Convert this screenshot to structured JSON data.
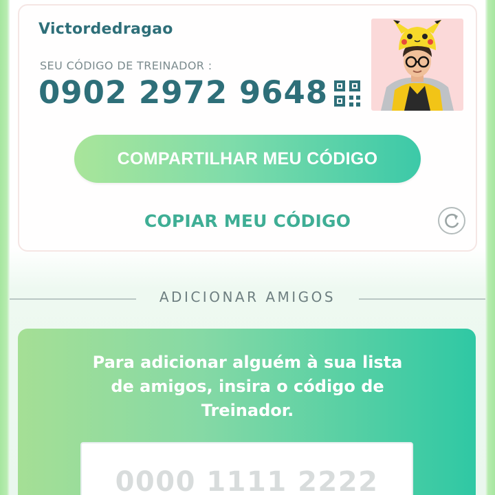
{
  "trainer": {
    "username": "Victordedragao",
    "code_label": "SEU CÓDIGO DE TREINADOR :",
    "code": "0902 2972 9648"
  },
  "icons": {
    "qr": "qr-code-icon",
    "refresh": "refresh-icon",
    "avatar": "trainer-avatar"
  },
  "actions": {
    "share_label": "COMPARTILHAR MEU CÓDIGO",
    "copy_label": "COPIAR MEU CÓDIGO"
  },
  "add_friends": {
    "section_title": "ADICIONAR AMIGOS",
    "instruction": "Para adicionar alguém à sua lista de amigos, insira o código de Treinador.",
    "input_placeholder": "0000 1111 2222"
  },
  "colors": {
    "accent_teal": "#2e6f79",
    "copy_green": "#3fae95",
    "gradient_start": "#a9e59a",
    "gradient_end": "#3cc9a8"
  }
}
